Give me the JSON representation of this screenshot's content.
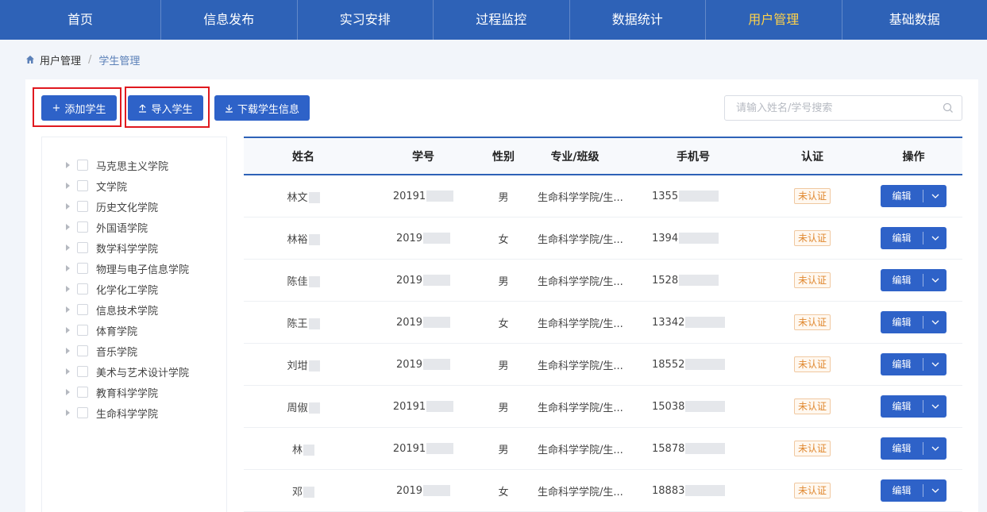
{
  "nav": {
    "items": [
      "首页",
      "信息发布",
      "实习安排",
      "过程监控",
      "数据统计",
      "用户管理",
      "基础数据"
    ],
    "active_index": 5
  },
  "breadcrumb": {
    "items": [
      "用户管理",
      "学生管理"
    ],
    "separator": "/"
  },
  "toolbar": {
    "add_label": "添加学生",
    "import_label": "导入学生",
    "download_label": "下载学生信息"
  },
  "search": {
    "placeholder": "请输入姓名/学号搜索"
  },
  "tree": {
    "items": [
      "马克思主义学院",
      "文学院",
      "历史文化学院",
      "外国语学院",
      "数学科学学院",
      "物理与电子信息学院",
      "化学化工学院",
      "信息技术学院",
      "体育学院",
      "音乐学院",
      "美术与艺术设计学院",
      "教育科学学院",
      "生命科学学院"
    ]
  },
  "table": {
    "columns": [
      "姓名",
      "学号",
      "性别",
      "专业/班级",
      "手机号",
      "认证",
      "操作"
    ],
    "rows": [
      {
        "name": "林文",
        "id": "20191",
        "gender": "男",
        "major": "生命科学学院/生...",
        "phone": "1355",
        "status": "未认证",
        "action": "编辑"
      },
      {
        "name": "林裕",
        "id": "2019",
        "gender": "女",
        "major": "生命科学学院/生...",
        "phone": "1394",
        "status": "未认证",
        "action": "编辑"
      },
      {
        "name": "陈佳",
        "id": "2019",
        "gender": "男",
        "major": "生命科学学院/生...",
        "phone": "1528",
        "status": "未认证",
        "action": "编辑"
      },
      {
        "name": "陈王",
        "id": "2019",
        "gender": "女",
        "major": "生命科学学院/生...",
        "phone": "13342",
        "status": "未认证",
        "action": "编辑"
      },
      {
        "name": "刘坩",
        "id": "2019",
        "gender": "男",
        "major": "生命科学学院/生...",
        "phone": "18552",
        "status": "未认证",
        "action": "编辑"
      },
      {
        "name": "周俶",
        "id": "20191",
        "gender": "男",
        "major": "生命科学学院/生...",
        "phone": "15038",
        "status": "未认证",
        "action": "编辑"
      },
      {
        "name": "林",
        "id": "20191",
        "gender": "男",
        "major": "生命科学学院/生...",
        "phone": "15878",
        "status": "未认证",
        "action": "编辑"
      },
      {
        "name": "邓",
        "id": "2019",
        "gender": "女",
        "major": "生命科学学院/生...",
        "phone": "18883",
        "status": "未认证",
        "action": "编辑"
      }
    ]
  },
  "colors": {
    "nav_bg": "#2e62b7",
    "nav_active": "#ffd24a",
    "primary": "#2e62c8",
    "highlight": "#e0191f",
    "badge": "#e0882f"
  }
}
